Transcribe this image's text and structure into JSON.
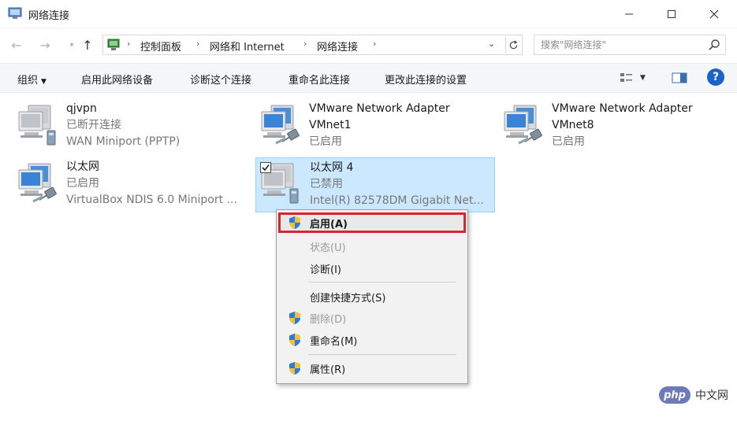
{
  "window": {
    "title": "网络连接",
    "controls": {
      "minimize": "minimize-icon",
      "maximize": "maximize-icon",
      "close": "close-icon"
    }
  },
  "address": {
    "breadcrumbs": [
      "控制面板",
      "网络和 Internet",
      "网络连接"
    ],
    "search_placeholder": "搜索\"网络连接\""
  },
  "commands": {
    "organize": "组织",
    "enable_device": "启用此网络设备",
    "diagnose": "诊断这个连接",
    "rename": "重命名此连接",
    "change_settings": "更改此连接的设置"
  },
  "connections": [
    {
      "name": "qjvpn",
      "line2": "已断开连接",
      "line3": "WAN Miniport (PPTP)",
      "icon": "vpn-connection-icon"
    },
    {
      "name": "VMware Network Adapter",
      "line2": "VMnet1",
      "line3": "已启用",
      "icon": "network-adapter-icon"
    },
    {
      "name": "VMware Network Adapter",
      "line2": "VMnet8",
      "line3": "已启用",
      "icon": "network-adapter-icon"
    },
    {
      "name": "以太网",
      "line2": "已启用",
      "line3": "VirtualBox NDIS 6.0 Miniport ...",
      "icon": "network-adapter-icon"
    },
    {
      "name": "以太网 4",
      "line2": "已禁用",
      "line3": "Intel(R) 82578DM Gigabit Net...",
      "icon": "network-adapter-icon",
      "selected": true
    }
  ],
  "context_menu": {
    "enable": "启用(A)",
    "status": "状态(U)",
    "diagnose": "诊断(I)",
    "shortcut": "创建快捷方式(S)",
    "delete": "删除(D)",
    "rename": "重命名(M)",
    "properties": "属性(R)"
  },
  "watermark": {
    "logo": "php",
    "text": "中文网"
  },
  "colors": {
    "selection_bg": "#cce8ff",
    "highlight_border": "#d8242b",
    "help": "#1a63c7"
  }
}
